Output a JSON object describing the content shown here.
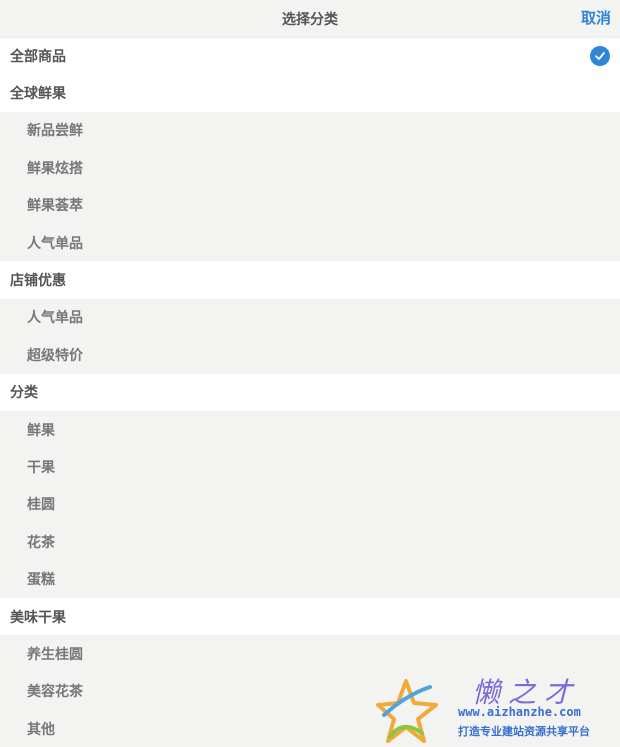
{
  "header": {
    "title": "选择分类",
    "cancel_label": "取消"
  },
  "categories": {
    "all": "全部商品",
    "global_fruits": {
      "label": "全球鲜果",
      "items": [
        "新品尝鲜",
        "鲜果炫搭",
        "鲜果荟萃",
        "人气单品"
      ]
    },
    "store_deals": {
      "label": "店铺优惠",
      "items": [
        "人气单品",
        "超级特价"
      ]
    },
    "category": {
      "label": "分类",
      "items": [
        "鲜果",
        "干果",
        "桂圆",
        "花茶",
        "蛋糕"
      ]
    },
    "tasty_dried": {
      "label": "美味干果",
      "items": [
        "养生桂圆",
        "美容花茶",
        "其他"
      ]
    }
  },
  "selected": "全部商品",
  "watermark": {
    "title": "懒之才",
    "url": "www.aizhanzhe.com",
    "slogan": "打造专业建站资源共享平台"
  },
  "colors": {
    "accent": "#2f86d6",
    "group_bg": "#ffffff",
    "sub_bg": "#f3f4f2"
  }
}
